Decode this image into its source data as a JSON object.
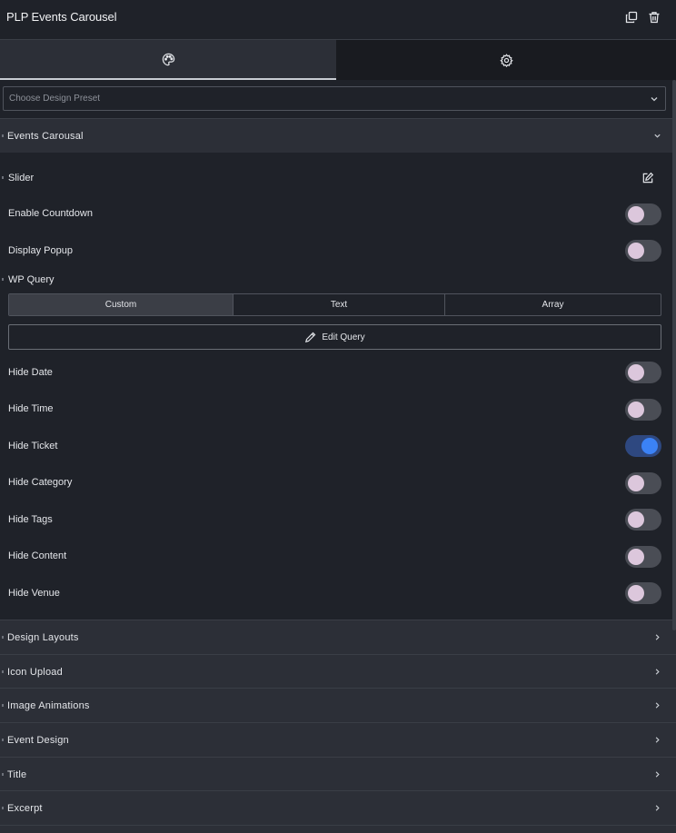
{
  "header": {
    "title": "PLP Events Carousel",
    "icons": [
      "copy-icon",
      "trash-icon"
    ]
  },
  "tabs": [
    {
      "icon": "palette-icon",
      "active": true
    },
    {
      "icon": "gear-icon",
      "active": false
    }
  ],
  "preset": {
    "placeholder": "Choose Design Preset"
  },
  "expanded_section": {
    "label": "Events Carousal",
    "slider_label": "Slider",
    "wp_query_label": "WP Query",
    "toggles": [
      {
        "label": "Enable Countdown",
        "on": false
      },
      {
        "label": "Display Popup",
        "on": false
      }
    ],
    "query_modes": [
      "Custom",
      "Text",
      "Array"
    ],
    "query_mode_selected": "Custom",
    "edit_query_label": "Edit Query",
    "hide_toggles": [
      {
        "label": "Hide Date",
        "on": false
      },
      {
        "label": "Hide Time",
        "on": false
      },
      {
        "label": "Hide Ticket",
        "on": true
      },
      {
        "label": "Hide Category",
        "on": false
      },
      {
        "label": "Hide Tags",
        "on": false
      },
      {
        "label": "Hide Content",
        "on": false
      },
      {
        "label": "Hide Venue",
        "on": false
      }
    ]
  },
  "collapsed_sections": [
    {
      "label": "Design Layouts"
    },
    {
      "label": "Icon Upload"
    },
    {
      "label": "Image Animations"
    },
    {
      "label": "Event Design"
    },
    {
      "label": "Title"
    },
    {
      "label": "Excerpt"
    }
  ],
  "colors": {
    "background": "#1f2229",
    "section_header": "#2c2f37",
    "toggle_off": "#4a4d55",
    "toggle_on": "#3b82f6",
    "knob_off": "#dcc7dc"
  }
}
